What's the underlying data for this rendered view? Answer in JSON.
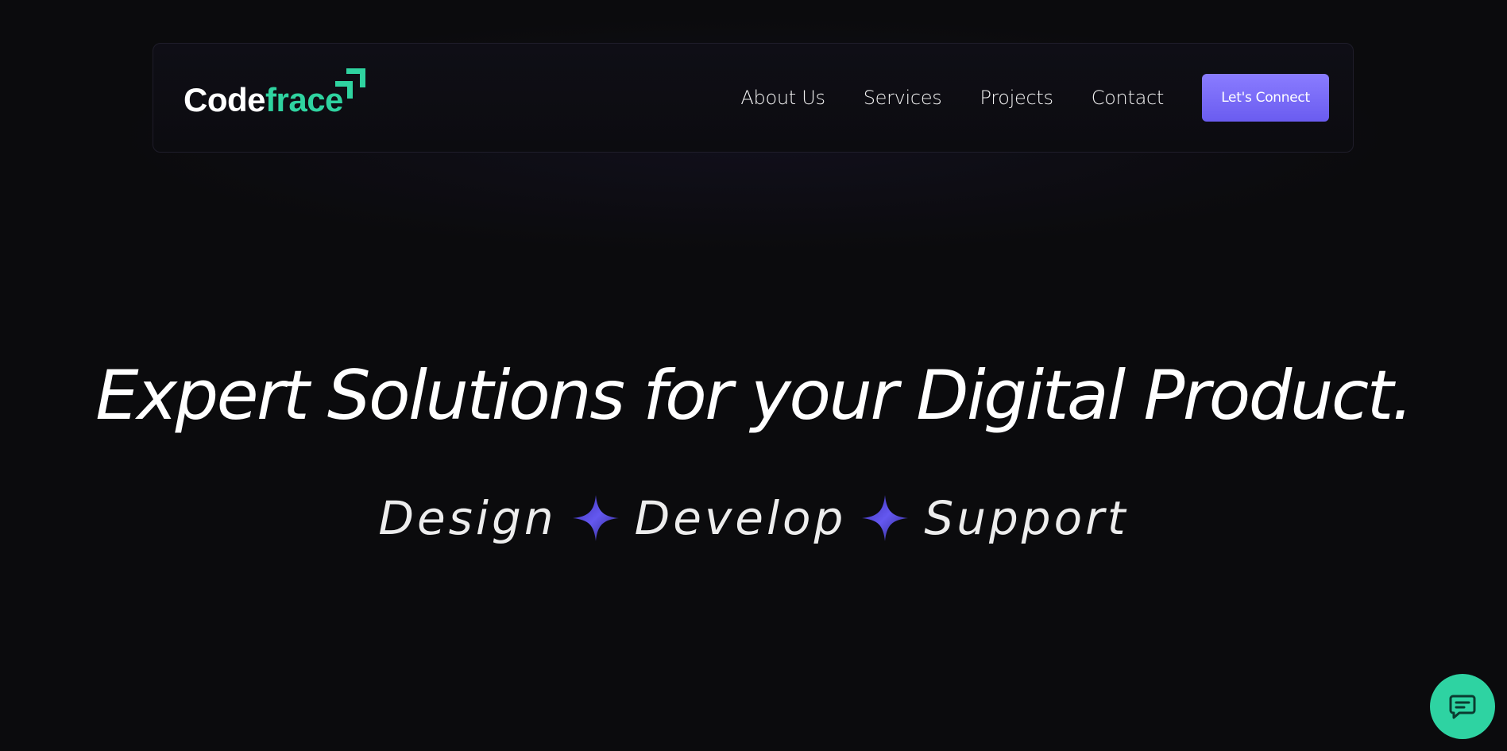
{
  "logo": {
    "part1": "Code",
    "part2": "frace",
    "colors": {
      "primary": "#ffffff",
      "accent": "#2fd3a0"
    }
  },
  "nav": {
    "items": [
      {
        "label": "About Us"
      },
      {
        "label": "Services"
      },
      {
        "label": "Projects"
      },
      {
        "label": "Contact"
      }
    ],
    "cta_label": "Let's Connect",
    "cta_color": "#7a6cf8"
  },
  "hero": {
    "title": "Expert Solutions for your Digital Product.",
    "tagline": [
      "Design",
      "Develop",
      "Support"
    ],
    "separator_icon": "sparkle-icon",
    "separator_color": "#5a4fe0"
  },
  "chat_widget": {
    "icon": "chat-icon",
    "color": "#2ed3a2"
  }
}
